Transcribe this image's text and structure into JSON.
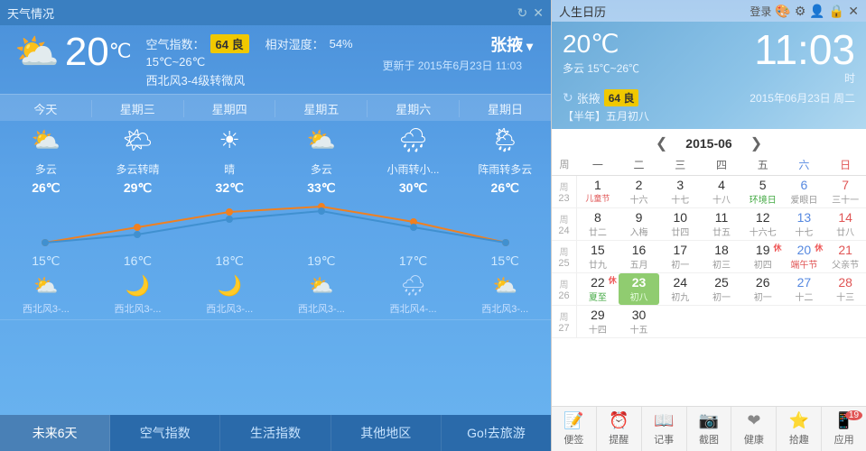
{
  "weather": {
    "title": "天气情况",
    "location": "张掖",
    "temp_current": "20",
    "temp_unit": "℃",
    "condition": "多云",
    "temp_range": "15℃~26℃",
    "aqi_label": "空气指数：",
    "aqi_value": "64 良",
    "humidity_label": "相对湿度：",
    "humidity_value": "54%",
    "wind": "西北风3-4级转微风",
    "update_time": "更新于 2015年6月23日 11:03",
    "forecast": [
      {
        "day": "今天",
        "icon": "⛅",
        "desc": "多云",
        "high": "26℃",
        "low": "15℃",
        "night_icon": "⛅",
        "wind": "西北风3-..."
      },
      {
        "day": "星期三",
        "icon": "🌤",
        "desc": "多云转晴",
        "high": "29℃",
        "low": "16℃",
        "night_icon": "🌙",
        "wind": "西北风3-..."
      },
      {
        "day": "星期四",
        "icon": "☀",
        "desc": "晴",
        "high": "32℃",
        "low": "18℃",
        "night_icon": "🌙",
        "wind": "西北风3-..."
      },
      {
        "day": "星期五",
        "icon": "⛅",
        "desc": "多云",
        "high": "33℃",
        "low": "19℃",
        "night_icon": "⛅",
        "wind": "西北风3-..."
      },
      {
        "day": "星期六",
        "icon": "🌧",
        "desc": "小雨转小...",
        "high": "30℃",
        "low": "17℃",
        "night_icon": "🌧",
        "wind": "西北风4-..."
      },
      {
        "day": "星期日",
        "icon": "🌦",
        "desc": "阵雨转多云",
        "high": "26℃",
        "low": "15℃",
        "night_icon": "⛅",
        "wind": "西北风3-..."
      }
    ],
    "tabs": [
      "未来6天",
      "空气指数",
      "生活指数",
      "其他地区",
      "Go!去旅游"
    ]
  },
  "calendar": {
    "title": "人生日历",
    "time": "11:03",
    "hour_label": "时",
    "temp": "20℃",
    "date_str": "2015年06月23日 周二",
    "lunar_label": "【半年】五月初八",
    "location": "张掖",
    "aqi": "64 良",
    "weather_desc": "多云 15℃~26℃",
    "month_label": "2015-06",
    "weekdays": [
      "一",
      "二",
      "三",
      "四",
      "五",
      "六",
      "日"
    ],
    "login": "登录",
    "rows": [
      {
        "week": "23",
        "days": [
          {
            "num": "1",
            "lunar": "儿童节",
            "type": "normal"
          },
          {
            "num": "2",
            "lunar": "十六",
            "type": "normal"
          },
          {
            "num": "3",
            "lunar": "十七",
            "type": "normal"
          },
          {
            "num": "4",
            "lunar": "十八",
            "type": "normal"
          },
          {
            "num": "5",
            "lunar": "环境日",
            "type": "normal"
          },
          {
            "num": "6",
            "lunar": "爱眼日",
            "type": "sat"
          },
          {
            "num": "7",
            "lunar": "三十一",
            "type": "sun"
          }
        ]
      },
      {
        "week": "24",
        "days": [
          {
            "num": "8",
            "lunar": "廿二",
            "type": "normal"
          },
          {
            "num": "9",
            "lunar": "入梅",
            "type": "normal"
          },
          {
            "num": "10",
            "lunar": "廿四",
            "type": "normal"
          },
          {
            "num": "11",
            "lunar": "廿五",
            "type": "normal"
          },
          {
            "num": "12",
            "lunar": "十六七",
            "type": "normal"
          },
          {
            "num": "13",
            "lunar": "十七",
            "type": "sat"
          },
          {
            "num": "14",
            "lunar": "廿八",
            "type": "sun"
          }
        ]
      },
      {
        "week": "25",
        "days": [
          {
            "num": "15",
            "lunar": "廿九",
            "type": "normal"
          },
          {
            "num": "16",
            "lunar": "五月",
            "type": "normal"
          },
          {
            "num": "17",
            "lunar": "初一",
            "type": "normal"
          },
          {
            "num": "18",
            "lunar": "初三",
            "type": "normal"
          },
          {
            "num": "19",
            "lunar": "初四",
            "type": "normal",
            "badge": "休"
          },
          {
            "num": "20",
            "lunar": "端午节",
            "type": "sat",
            "badge": "休"
          },
          {
            "num": "21",
            "lunar": "父亲节",
            "type": "sun"
          }
        ]
      },
      {
        "week": "26",
        "days": [
          {
            "num": "22",
            "lunar": "夏至",
            "type": "normal",
            "badge": "休"
          },
          {
            "num": "23",
            "lunar": "初八",
            "type": "today"
          },
          {
            "num": "24",
            "lunar": "初九",
            "type": "normal"
          },
          {
            "num": "25",
            "lunar": "初一",
            "type": "normal"
          },
          {
            "num": "26",
            "lunar": "初一",
            "type": "normal"
          },
          {
            "num": "27",
            "lunar": "十二",
            "type": "sat"
          },
          {
            "num": "28",
            "lunar": "十三",
            "type": "sun"
          }
        ]
      },
      {
        "week": "27",
        "days": [
          {
            "num": "29",
            "lunar": "十四",
            "type": "normal"
          },
          {
            "num": "30",
            "lunar": "十五",
            "type": "normal"
          },
          {
            "num": "",
            "lunar": "",
            "type": "other"
          },
          {
            "num": "",
            "lunar": "",
            "type": "other"
          },
          {
            "num": "",
            "lunar": "",
            "type": "other"
          },
          {
            "num": "",
            "lunar": "",
            "type": "other"
          },
          {
            "num": "",
            "lunar": "",
            "type": "other"
          }
        ]
      }
    ],
    "toolbar": [
      {
        "icon": "📝",
        "label": "便签"
      },
      {
        "icon": "⏰",
        "label": "提醒"
      },
      {
        "icon": "📖",
        "label": "记事"
      },
      {
        "icon": "📷",
        "label": "截图"
      },
      {
        "icon": "❤",
        "label": "健康"
      },
      {
        "icon": "⭐",
        "label": "拾趣"
      },
      {
        "icon": "📱",
        "label": "应用",
        "badge": "19"
      }
    ]
  }
}
